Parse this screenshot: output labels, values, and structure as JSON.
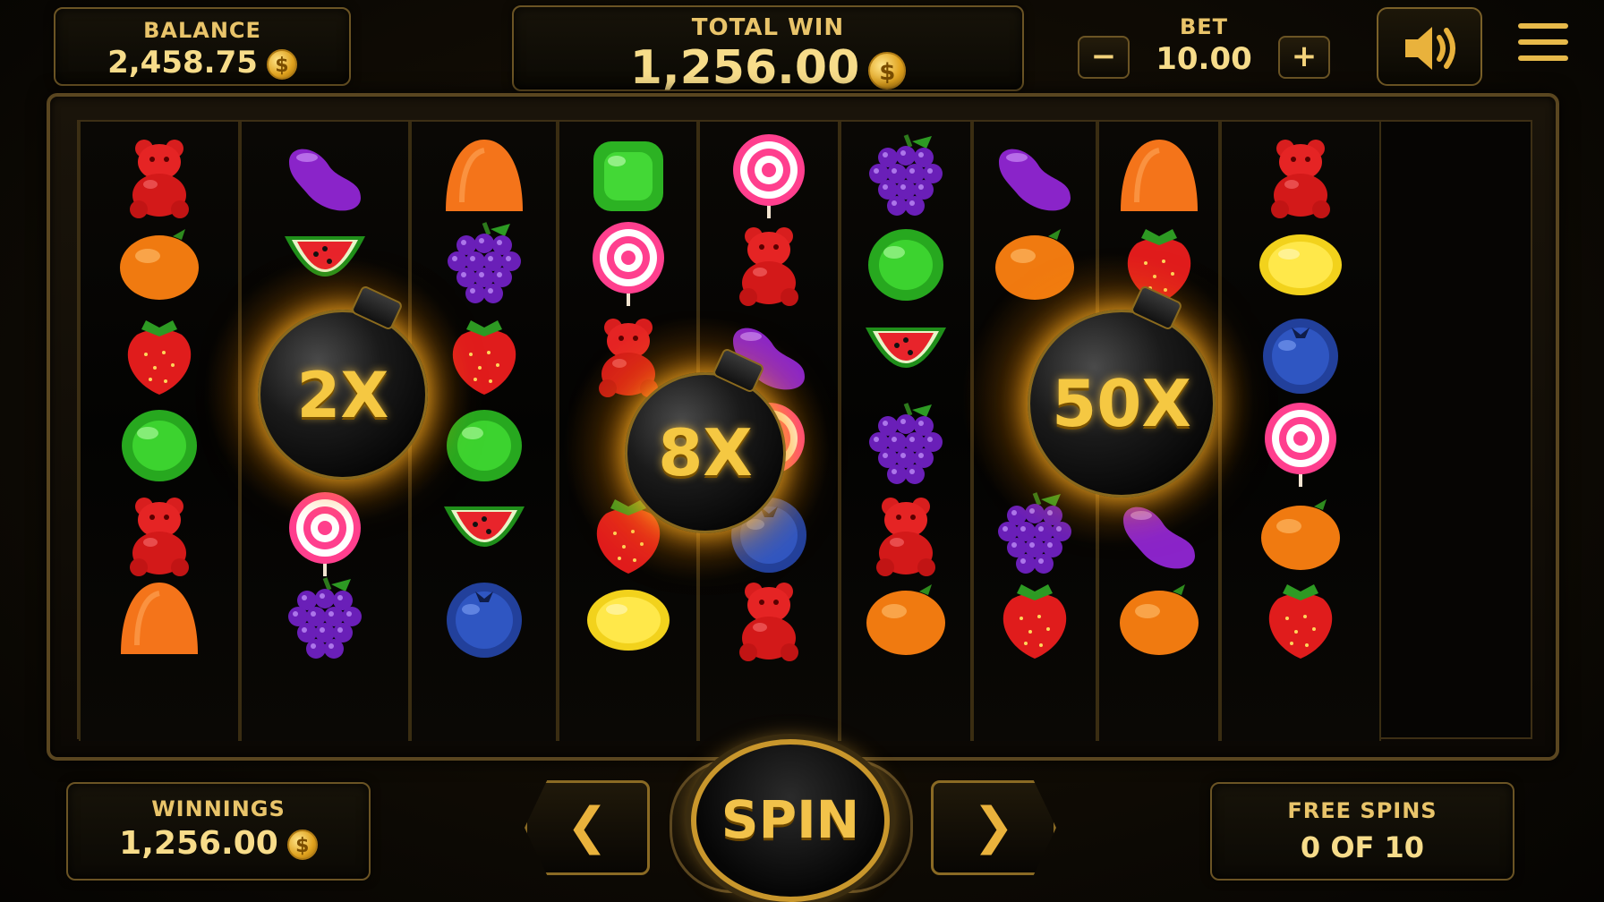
{
  "header": {
    "balance_label": "BALANCE",
    "balance_value": "2,458.75",
    "total_win_label": "TOTAL WIN",
    "total_win_value": "1,256.00",
    "bet_label": "BET",
    "bet_value": "10.00",
    "bet_minus": "−",
    "bet_plus": "+",
    "coin_glyph": "$"
  },
  "reels": [
    [
      "red-gummy-bear",
      "orange-fruit",
      "strawberry",
      "green-candy",
      "red-gummy-bear",
      "orange-gumdrop"
    ],
    [
      "purple-jellybean",
      "watermelon",
      "bomb",
      "bomb",
      "pink-swirl-lollipop",
      "grapes"
    ],
    [
      "orange-gumdrop",
      "grapes",
      "strawberry",
      "green-candy",
      "watermelon",
      "blueberry"
    ],
    [
      "green-square-candy",
      "pink-swirl-lollipop",
      "red-gummy-bear",
      "bomb",
      "strawberry",
      "lemon"
    ],
    [
      "pink-swirl-lollipop",
      "red-gummy-bear",
      "purple-jellybean",
      "pink-swirl-lollipop",
      "blueberry",
      "red-gummy-bear"
    ],
    [
      "grapes",
      "green-candy",
      "watermelon",
      "grapes",
      "red-gummy-bear",
      "orange-fruit"
    ],
    [
      "purple-jellybean",
      "orange-fruit",
      "bomb",
      "bomb",
      "grapes",
      "strawberry"
    ],
    [
      "orange-gumdrop",
      "strawberry",
      "bomb",
      "bomb",
      "purple-jellybean",
      "orange-fruit"
    ],
    [
      "red-gummy-bear",
      "lemon",
      "blueberry",
      "pink-swirl-lollipop",
      "orange-fruit",
      "strawberry"
    ]
  ],
  "bombs": [
    {
      "multiplier": "2X"
    },
    {
      "multiplier": "8X"
    },
    {
      "multiplier": "50X"
    }
  ],
  "footer": {
    "winnings_label": "WINNINGS",
    "winnings_value": "1,256.00",
    "spin_label": "SPIN",
    "prev_label": "❮",
    "next_label": "❯",
    "free_spins_label": "FREE SPINS",
    "free_spins_value": "0 OF 10"
  },
  "icons": {
    "sound": "speaker-icon",
    "menu": "hamburger-menu-icon"
  },
  "colors": {
    "gold": "#f3d27a",
    "accent": "#e9b23c",
    "background": "#0b0904"
  }
}
